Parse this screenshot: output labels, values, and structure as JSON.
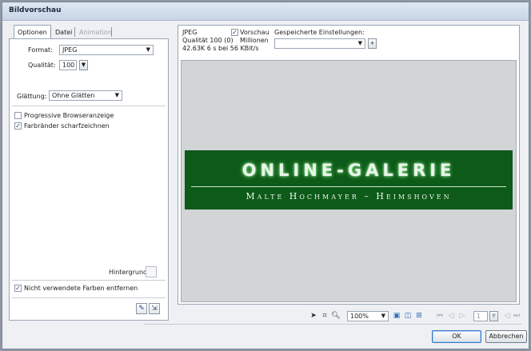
{
  "window": {
    "title": "Bildvorschau"
  },
  "tabs": [
    {
      "label": "Optionen"
    },
    {
      "label": "Datei"
    },
    {
      "label": "Animation"
    }
  ],
  "options": {
    "format_label": "Format:",
    "format_value": "JPEG",
    "quality_label": "Qualität:",
    "quality_value": "100",
    "smoothing_label": "Glättung:",
    "smoothing_value": "Ohne Glätten",
    "progressive_label": "Progressive Browseranzeige",
    "progressive_checked": false,
    "sharpen_label": "Farbränder scharfzeichnen",
    "sharpen_checked": true,
    "background_label": "Hintergrund:",
    "remove_unused_label": "Nicht verwendete Farben entfernen",
    "remove_unused_checked": true
  },
  "preview_info": {
    "format": "JPEG",
    "quality": "Qualität 100 (0)",
    "size": "42.63K  6 s bei 56 KBit/s",
    "preview_label": "Vorschau",
    "preview_checked": true,
    "colors": "Millionen",
    "saved_settings_label": "Gespeicherte Einstellungen:",
    "saved_settings_value": ""
  },
  "preview_image": {
    "title": "ONLINE-GALERIE",
    "subtitle": "Malte Hochmayer – Heimshoven",
    "bg_color": "#0d5a19"
  },
  "toolbar": {
    "zoom_value": "100%",
    "frame_value": "1",
    "icons": [
      "pointer-icon",
      "crop-icon",
      "zoom-icon",
      "view-1-icon",
      "view-2-icon",
      "view-4-icon",
      "first-frame-icon",
      "prev-frame-icon",
      "next-frame-icon",
      "last-frame-icon"
    ]
  },
  "buttons": {
    "ok": "OK",
    "cancel": "Abbrechen"
  }
}
